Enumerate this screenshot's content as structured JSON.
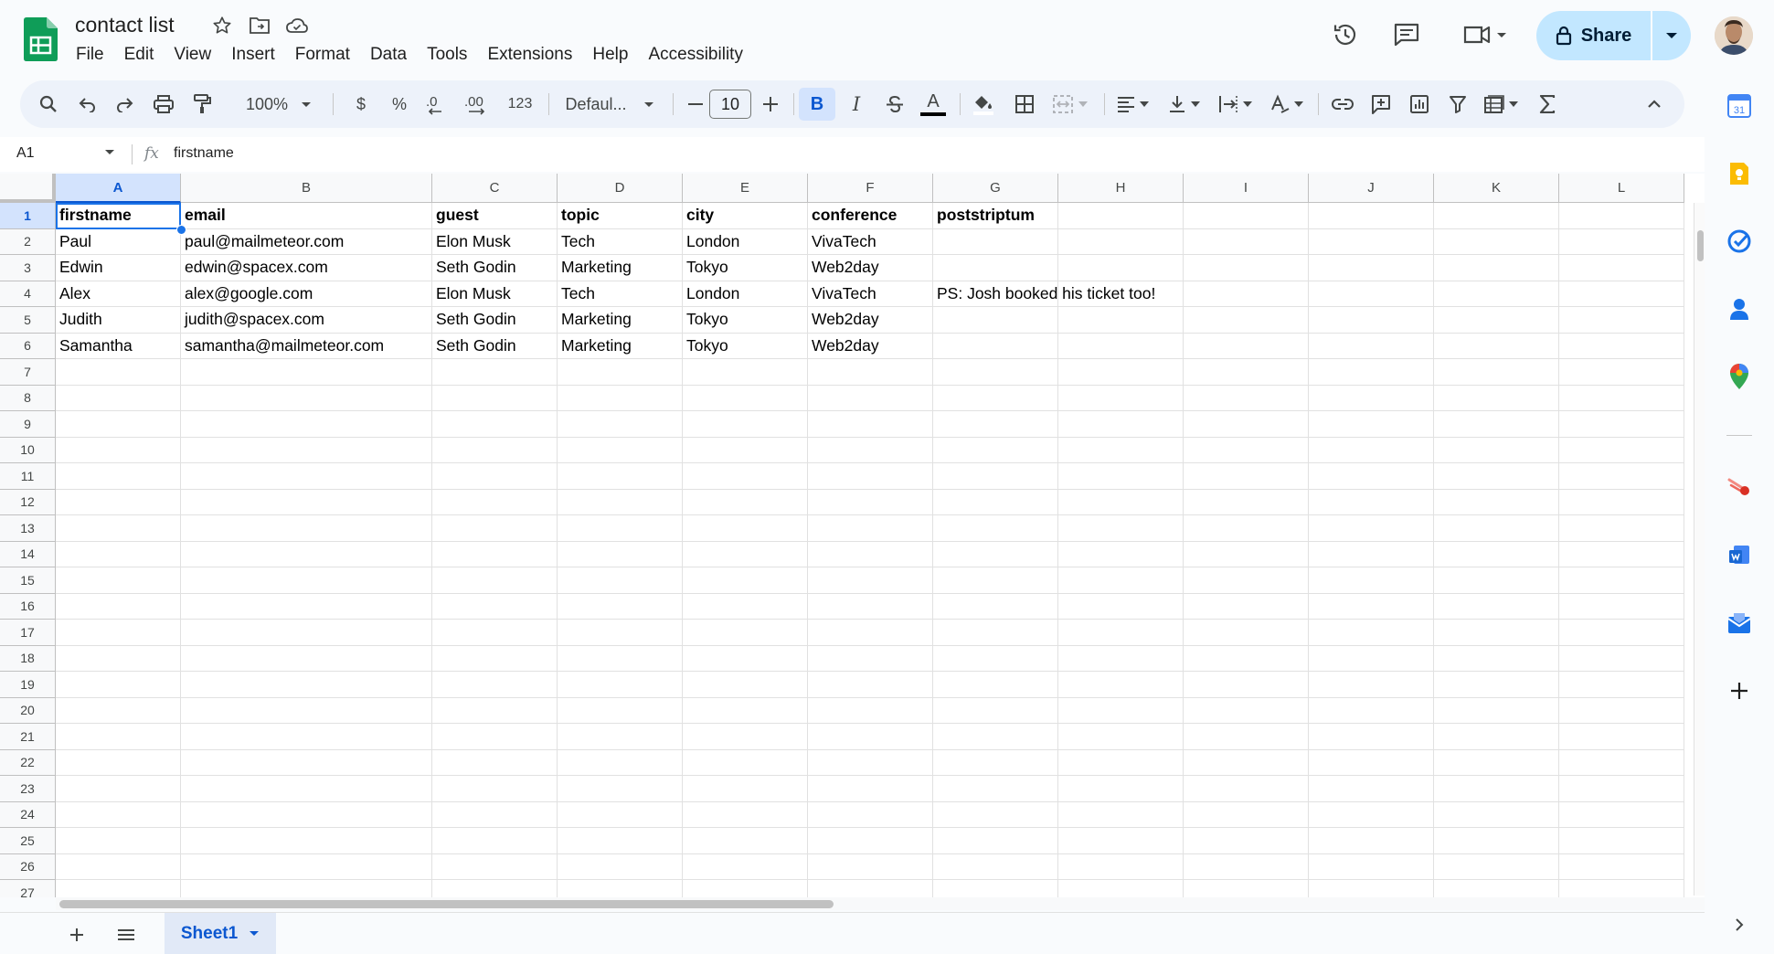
{
  "app": {
    "title": "contact list",
    "menu": [
      "File",
      "Edit",
      "View",
      "Insert",
      "Format",
      "Data",
      "Tools",
      "Extensions",
      "Help",
      "Accessibility"
    ],
    "share_label": "Share"
  },
  "toolbar": {
    "zoom": "100%",
    "currency": "$",
    "percent": "%",
    "decrease_decimals": ".0",
    "increase_decimals": ".00",
    "number_format": "123",
    "font": "Defaul...",
    "font_size": "10",
    "bold": "B",
    "italic": "I",
    "text_color_letter": "A"
  },
  "formula_bar": {
    "cell_ref": "A1",
    "fx": "fx",
    "value": "firstname"
  },
  "grid": {
    "columns": [
      "A",
      "B",
      "C",
      "D",
      "E",
      "F",
      "G",
      "H",
      "I",
      "J",
      "K",
      "L"
    ],
    "selected_cell": "A1",
    "row_count": 27,
    "rows": [
      [
        "firstname",
        "email",
        "guest",
        "topic",
        "city",
        "conference",
        "poststriptum"
      ],
      [
        "Paul",
        "paul@mailmeteor.com",
        "Elon Musk",
        "Tech",
        "London",
        "VivaTech",
        ""
      ],
      [
        "Edwin",
        "edwin@spacex.com",
        "Seth Godin",
        "Marketing",
        "Tokyo",
        "Web2day",
        ""
      ],
      [
        "Alex",
        "alex@google.com",
        "Elon Musk",
        "Tech",
        "London",
        "VivaTech",
        "PS: Josh booked his ticket too!"
      ],
      [
        "Judith",
        "judith@spacex.com",
        "Seth Godin",
        "Marketing",
        "Tokyo",
        "Web2day",
        ""
      ],
      [
        "Samantha",
        "samantha@mailmeteor.com",
        "Seth Godin",
        "Marketing",
        "Tokyo",
        "Web2day",
        ""
      ]
    ]
  },
  "sheets": {
    "active": "Sheet1"
  },
  "side_panel": {
    "icons": [
      "calendar-icon",
      "keep-icon",
      "tasks-icon",
      "contacts-icon",
      "maps-icon",
      "mailmeteor-icon",
      "docs-addon-icon",
      "mail-merge-icon",
      "add-icon"
    ]
  },
  "colors": {
    "accent": "#0b57d0",
    "selection": "#1a73e8",
    "share_bg": "#c2e7ff",
    "sheets_green": "#0f9d58"
  }
}
